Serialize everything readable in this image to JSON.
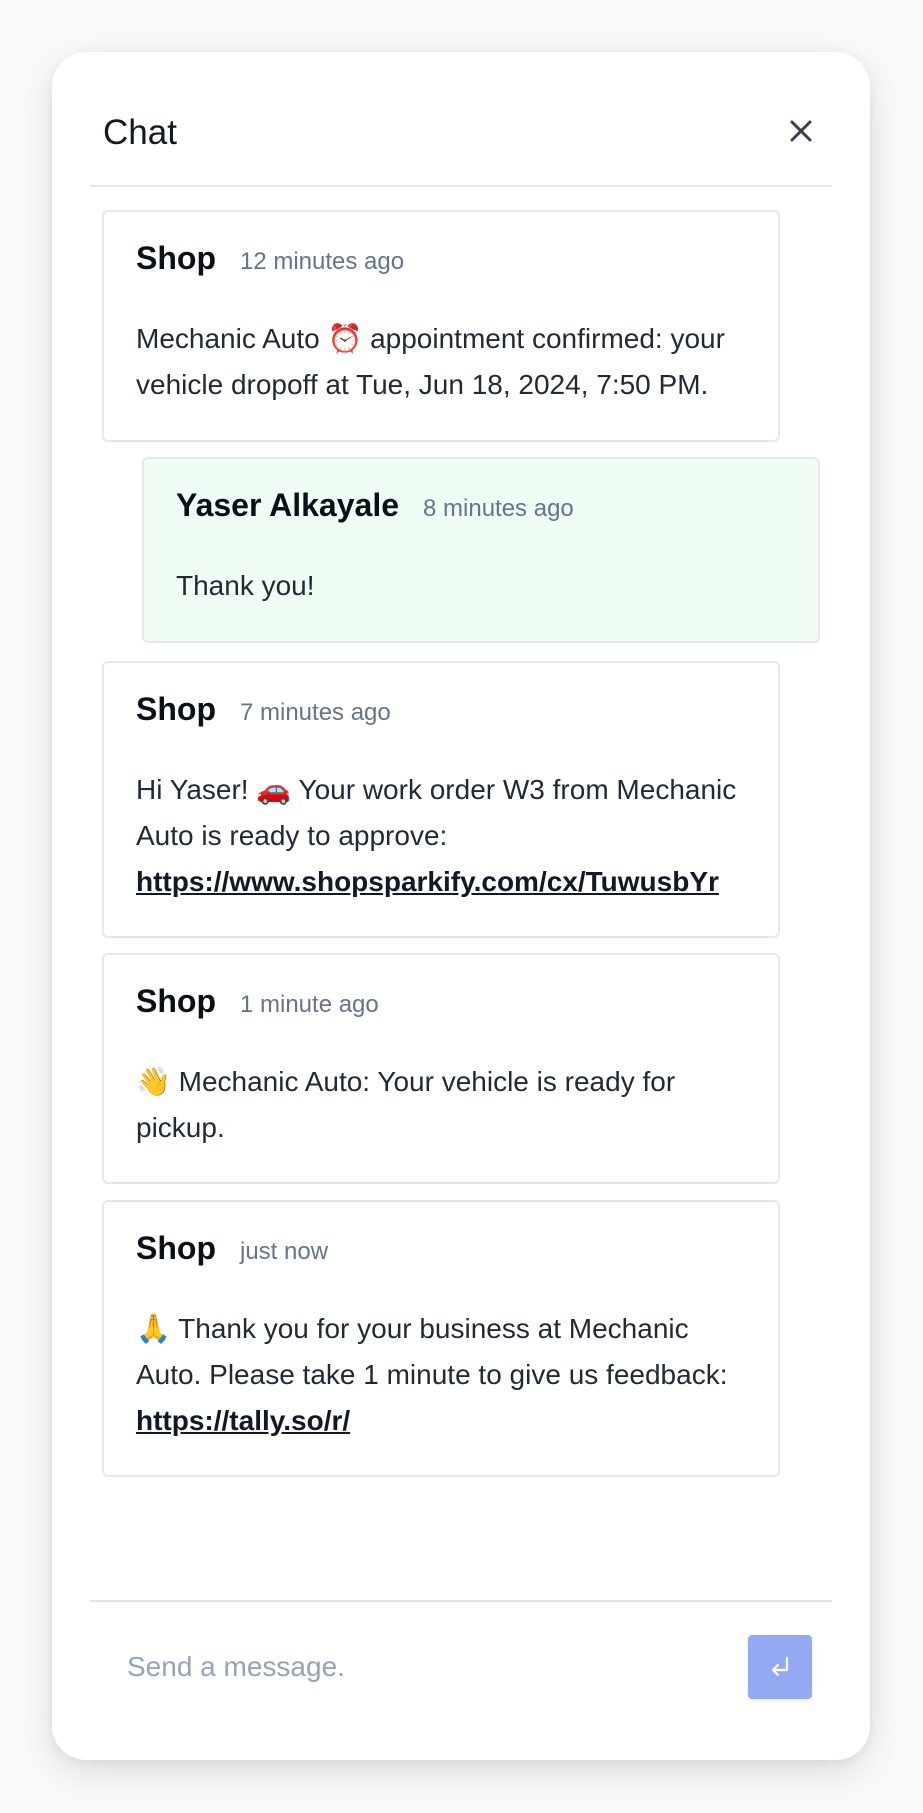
{
  "chat": {
    "title": "Chat",
    "close_icon": "close-icon"
  },
  "messages": [
    {
      "sender": "Shop",
      "time": "12 minutes ago",
      "text": "Mechanic Auto ⏰ appointment confirmed: your vehicle dropoff at Tue, Jun 18, 2024, 7:50 PM.",
      "link": ""
    },
    {
      "sender": "Yaser Alkayale",
      "time": "8 minutes ago",
      "text": "Thank you!",
      "link": ""
    },
    {
      "sender": "Shop",
      "time": "7 minutes ago",
      "text": "Hi Yaser! 🚗 Your work order W3 from Mechanic Auto is ready to approve:",
      "link": "https://www.shopsparkify.com/cx/TuwusbYr"
    },
    {
      "sender": "Shop",
      "time": "1 minute ago",
      "text": "👋 Mechanic Auto: Your vehicle is ready for pickup.",
      "link": ""
    },
    {
      "sender": "Shop",
      "time": "just now",
      "text": "🙏 Thank you for your business at Mechanic Auto. Please take 1 minute to give us feedback:",
      "link": "https://tally.so/r/"
    }
  ],
  "composer": {
    "placeholder": "Send a message.",
    "value": "",
    "send_icon": "return-icon"
  },
  "colors": {
    "user_bubble": "#f0fdf4",
    "send_button": "#93a9f4"
  }
}
